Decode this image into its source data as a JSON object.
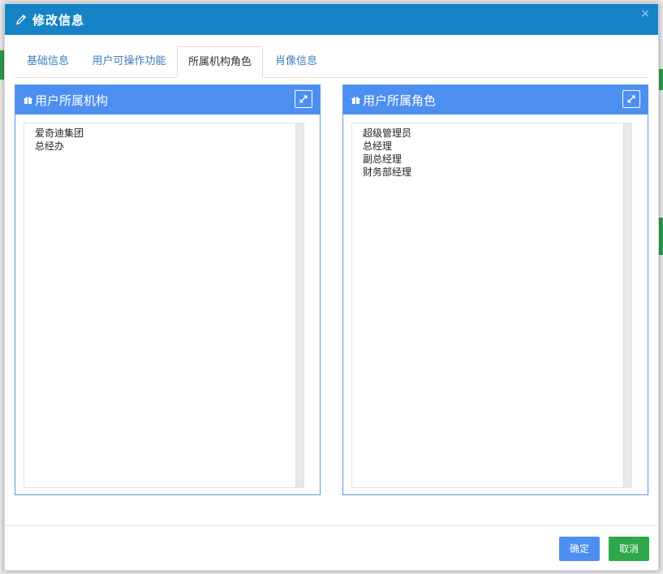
{
  "modal": {
    "title": "修改信息",
    "close_label": "×"
  },
  "tabs": [
    {
      "label": "基础信息",
      "active": false
    },
    {
      "label": "用户可操作功能",
      "active": false
    },
    {
      "label": "所属机构角色",
      "active": true
    },
    {
      "label": "肖像信息",
      "active": false
    }
  ],
  "panels": {
    "org": {
      "title": "用户所属机构",
      "items": [
        "爱奇迪集团",
        "总经办"
      ]
    },
    "role": {
      "title": "用户所属角色",
      "items": [
        "超级管理员",
        "总经理",
        "副总经理",
        "财务部经理"
      ]
    }
  },
  "footer": {
    "confirm_label": "确定",
    "cancel_label": "取消"
  },
  "colors": {
    "header_blue": "#1484c6",
    "panel_blue": "#4d8ff1",
    "confirm_blue": "#4d8ff1",
    "cancel_green": "#2ea84a"
  },
  "icons": {
    "header": "pencil-icon",
    "panel": "gift-icon",
    "expand": "expand-arrows-icon"
  }
}
